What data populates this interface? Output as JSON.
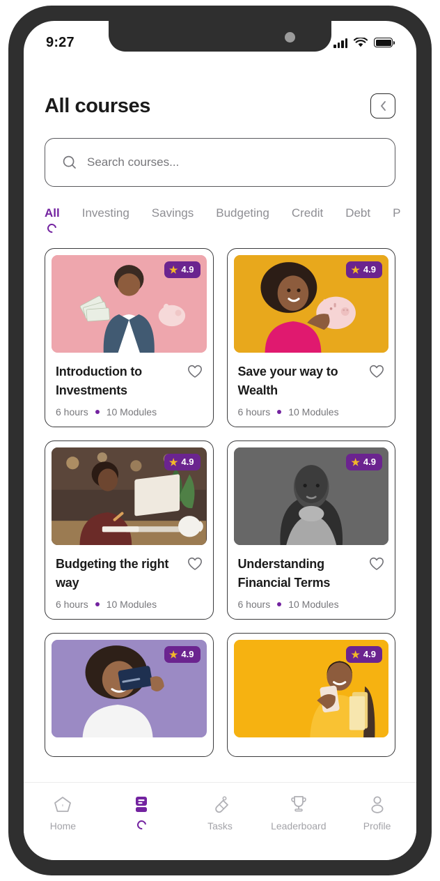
{
  "status_bar": {
    "time": "9:27",
    "icons": [
      "signal-bars-icon",
      "wifi-icon",
      "battery-icon"
    ]
  },
  "header": {
    "title": "All courses",
    "back_icon": "chevron-left-icon"
  },
  "search": {
    "placeholder": "Search courses...",
    "value": "",
    "icon": "search-icon"
  },
  "tabs": {
    "active_index": 0,
    "items": [
      {
        "label": "All"
      },
      {
        "label": "Investing"
      },
      {
        "label": "Savings"
      },
      {
        "label": "Budgeting"
      },
      {
        "label": "Credit"
      },
      {
        "label": "Debt"
      },
      {
        "label": "P"
      }
    ]
  },
  "courses": [
    {
      "title": "Introduction to Investments",
      "rating": "4.9",
      "duration": "6 hours",
      "modules": "10 Modules",
      "favorite": false,
      "thumb_bg": "#eea6ad",
      "thumb_name": "man-holding-cash-and-piggy-bank-photo"
    },
    {
      "title": "Save your way to Wealth",
      "rating": "4.9",
      "duration": "6 hours",
      "modules": "10 Modules",
      "favorite": false,
      "thumb_bg": "#e8a81c",
      "thumb_name": "girl-holding-piggy-bank-photo"
    },
    {
      "title": "Budgeting the right way",
      "rating": "4.9",
      "duration": "6 hours",
      "modules": "10 Modules",
      "favorite": false,
      "thumb_bg": "#4b3a32",
      "thumb_name": "woman-writing-at-laptop-photo"
    },
    {
      "title": "Understanding Financial Terms",
      "rating": "4.9",
      "duration": "6 hours",
      "modules": "10 Modules",
      "favorite": false,
      "thumb_bg": "#6e6e6e",
      "thumb_name": "woman-portrait-grayscale-photo"
    },
    {
      "title": "",
      "rating": "4.9",
      "duration": "",
      "modules": "",
      "favorite": false,
      "thumb_bg": "#9b8ac4",
      "thumb_name": "girl-holding-credit-card-photo"
    },
    {
      "title": "",
      "rating": "4.9",
      "duration": "",
      "modules": "",
      "favorite": false,
      "thumb_bg": "#f6b211",
      "thumb_name": "student-with-phone-photo"
    }
  ],
  "bottom_nav": {
    "active_index": 1,
    "items": [
      {
        "label": "Home",
        "icon": "home-icon"
      },
      {
        "label": "",
        "icon": "courses-book-icon"
      },
      {
        "label": "Tasks",
        "icon": "tasks-icon"
      },
      {
        "label": "Leaderboard",
        "icon": "trophy-icon"
      },
      {
        "label": "Profile",
        "icon": "person-icon"
      }
    ]
  },
  "colors": {
    "accent_purple": "#7323a0",
    "badge_purple": "#6b248f",
    "star_gold": "#f2b829",
    "text_dark": "#1b1b1b",
    "text_muted": "#8e8e93",
    "frame_dark": "#2f2f2f"
  }
}
